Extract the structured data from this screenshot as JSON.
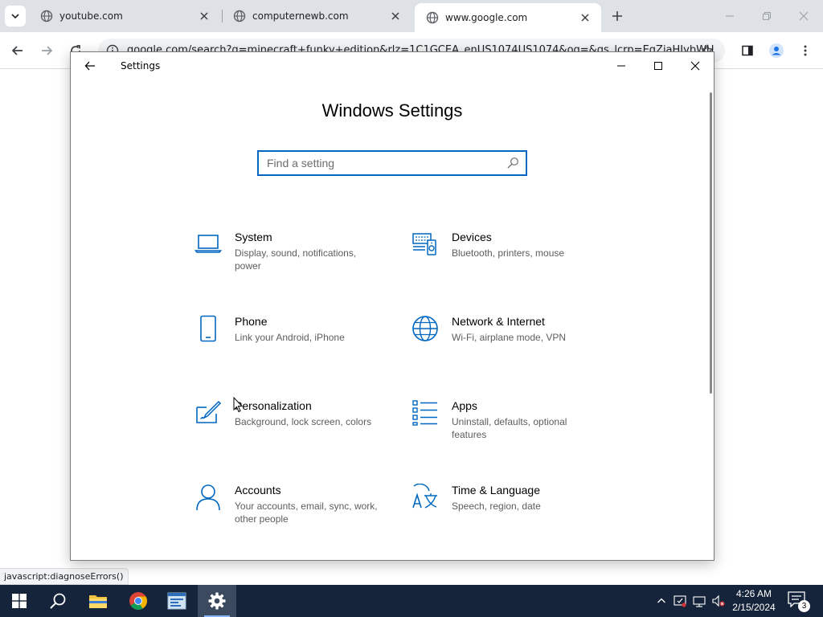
{
  "browser": {
    "tabs": [
      {
        "title": "youtube.com",
        "active": false
      },
      {
        "title": "computernewb.com",
        "active": false
      },
      {
        "title": "www.google.com",
        "active": true
      }
    ],
    "new_tab_label": "+",
    "url": "google.com/search?q=minecraft+funky+edition&rlz=1C1GCEA_enUS1074US1074&oq=&gs_lcrp=EgZjaHJvbWU",
    "status_text": "javascript:diagnoseErrors()"
  },
  "settings": {
    "window_title": "Settings",
    "heading": "Windows Settings",
    "search_placeholder": "Find a setting",
    "accent_color": "#0067c0",
    "categories": [
      {
        "name": "System",
        "desc": "Display, sound, notifications, power",
        "icon": "laptop-icon"
      },
      {
        "name": "Devices",
        "desc": "Bluetooth, printers, mouse",
        "icon": "devices-icon"
      },
      {
        "name": "Phone",
        "desc": "Link your Android, iPhone",
        "icon": "phone-icon"
      },
      {
        "name": "Network & Internet",
        "desc": "Wi-Fi, airplane mode, VPN",
        "icon": "globe-icon"
      },
      {
        "name": "Personalization",
        "desc": "Background, lock screen, colors",
        "icon": "paint-icon"
      },
      {
        "name": "Apps",
        "desc": "Uninstall, defaults, optional features",
        "icon": "apps-list-icon"
      },
      {
        "name": "Accounts",
        "desc": "Your accounts, email, sync, work, other people",
        "icon": "person-icon"
      },
      {
        "name": "Time & Language",
        "desc": "Speech, region, date",
        "icon": "time-language-icon"
      }
    ]
  },
  "taskbar": {
    "time": "4:26 AM",
    "date": "2/15/2024",
    "notification_count": "3",
    "background_color": "#15243a"
  }
}
